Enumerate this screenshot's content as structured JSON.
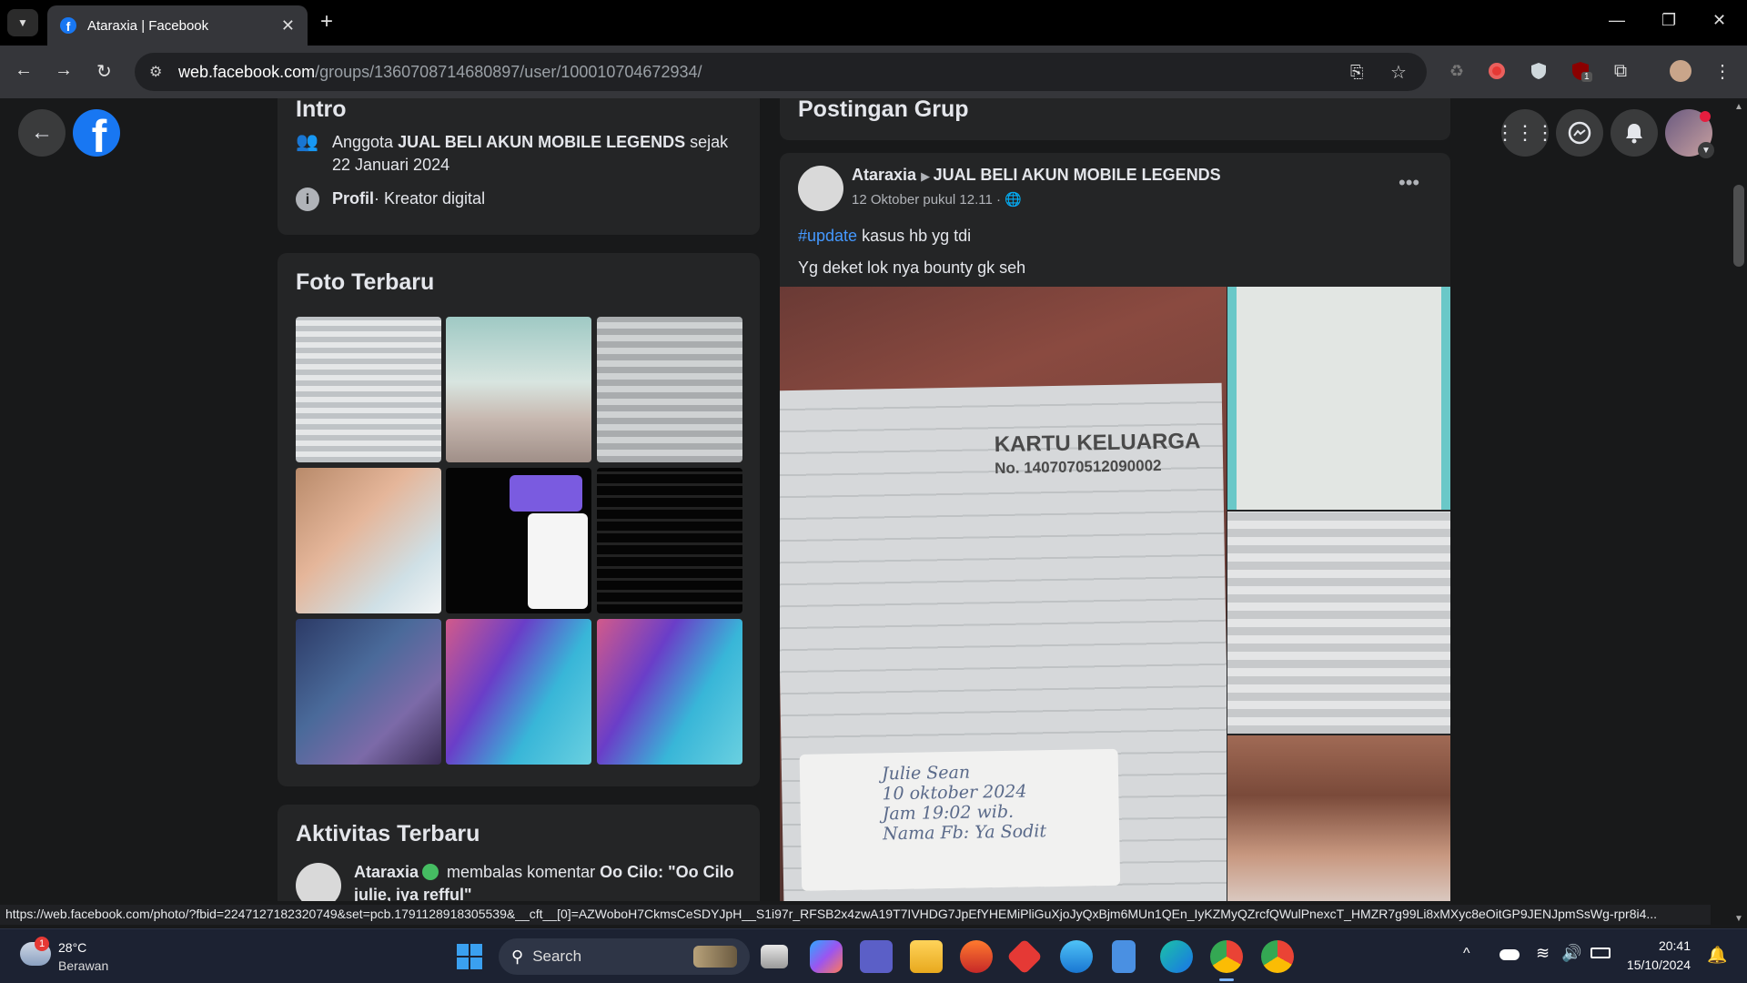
{
  "browser": {
    "tab_title": "Ataraxia | Facebook",
    "url_host": "web.facebook.com",
    "url_path": "/groups/1360708714680897/user/100010704672934/",
    "extension_badge": "1",
    "status_url": "https://web.facebook.com/photo/?fbid=2247127182320749&set=pcb.1791128918305539&__cft__[0]=AZWoboH7CkmsCeSDYJpH__S1i97r_RFSB2x4zwA19T7IVHDG7JpEfYHEMiPliGuXjoJyQxBjm6MUn1QEn_IyKZMyQZrcfQWulPnexcT_HMZR7g99Li8xMXyc8eOitGP9JENJpmSsWg-rpr8i4..."
  },
  "intro": {
    "title": "Intro",
    "member_prefix": "Anggota ",
    "group_name": "JUAL BELI AKUN MOBILE LEGENDS",
    "member_suffix": " sejak 22 Januari 2024",
    "profile_label": "Profil",
    "profile_desc": " · Kreator digital"
  },
  "photos": {
    "title": "Foto Terbaru"
  },
  "activity": {
    "title": "Aktivitas Terbaru",
    "name": "Ataraxia",
    "action": " membalas komentar ",
    "target": "Oo Cilo",
    "quote": ": \"Oo Cilo julie, iya refful\""
  },
  "posts_section": {
    "title": "Postingan Grup"
  },
  "post": {
    "author": "Ataraxia",
    "group": "JUAL BELI AKUN MOBILE LEGENDS",
    "time": "12 Oktober pukul 12.11 ·",
    "hashtag": "#update",
    "line1_rest": " kasus hb yg tdi",
    "line2": "Yg deket lok nya bounty gk seh",
    "doc_title": "KARTU KELUARGA",
    "doc_number": "No. 1407070512090002",
    "note_lines": [
      "Julie Sean",
      "10 oktober 2024",
      "Jam 19:02 wib.",
      "Nama Fb: Ya Sodit"
    ]
  },
  "taskbar": {
    "weather_temp": "28°C",
    "weather_desc": "Berawan",
    "weather_badge": "1",
    "search_label": "Search",
    "time": "20:41",
    "date": "15/10/2024"
  }
}
